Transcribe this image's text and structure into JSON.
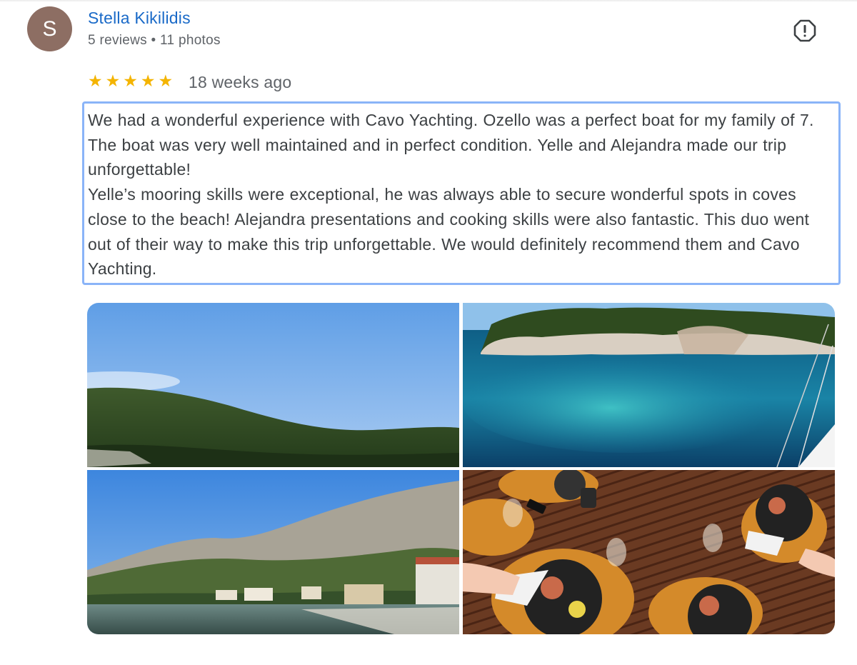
{
  "review": {
    "author_initial": "S",
    "author_name": "Stella Kikilidis",
    "author_meta": "5 reviews • 11 photos",
    "rating": 5,
    "time_ago": "18 weeks ago",
    "paragraph_1": "We had a wonderful experience with Cavo Yachting. Ozello was a perfect boat for my family of 7. The boat was very well maintained and in perfect condition. Yelle and Alejandra made our trip unforgettable!",
    "paragraph_2": "Yelle’s mooring skills were exceptional, he was always able to secure wonderful spots in coves close to the beach! Alejandra presentations and cooking skills were also fantastic. This duo went out of their way to make this trip unforgettable. We would definitely recommend them and Cavo Yachting."
  },
  "icons": {
    "report": "report-flag-icon",
    "star": "star-icon"
  },
  "colors": {
    "author_link": "#1a6ac8",
    "star": "#f4b400",
    "avatar_bg": "#8d6e63",
    "selection_border": "#8ab4f8"
  }
}
